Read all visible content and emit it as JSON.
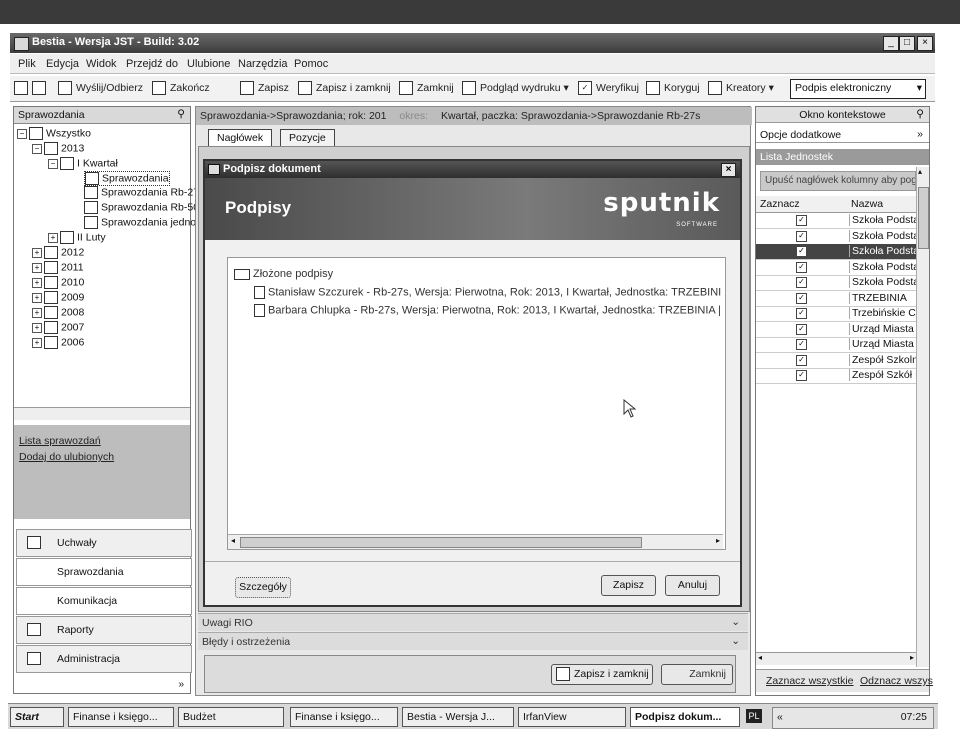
{
  "window": {
    "title": "Bestia - Wersja JST - Build: 3.02"
  },
  "menu": [
    "Plik",
    "Edycja",
    "Widok",
    "Przejdź do",
    "Ulubione",
    "Narzędzia",
    "Pomoc"
  ],
  "toolbar": {
    "send_receive": "Wyślij/Odbierz",
    "finish": "Zakończ",
    "save": "Zapisz",
    "save_close": "Zapisz i zamknij",
    "close": "Zamknij",
    "print_preview": "Podgląd wydruku",
    "verify": "Weryfikuj",
    "correct": "Koryguj",
    "wizards": "Kreatory",
    "e_signature": "Podpis elektroniczny"
  },
  "left_pane": {
    "title": "Sprawozdania",
    "tree": {
      "root": "Wszystko",
      "year_2013": "2013",
      "q1": "I Kwartał",
      "q1_children": [
        "Sprawozdania",
        "Sprawozdania Rb-27",
        "Sprawozdania Rb-50",
        "Sprawozdania jedno"
      ],
      "feb": "II Luty",
      "years": [
        "2012",
        "2011",
        "2010",
        "2009",
        "2008",
        "2007",
        "2006"
      ]
    },
    "links": {
      "report_list": "Lista sprawozdań",
      "add_favorites": "Dodaj do ulubionych"
    },
    "nav": {
      "resolutions": "Uchwały",
      "reports": "Sprawozdania",
      "communication": "Komunikacja",
      "raports": "Raporty",
      "admin": "Administracja"
    }
  },
  "center": {
    "breadcrumb_left": "Sprawozdania->Sprawozdania; rok: 201",
    "breadcrumb_mid": "okres:",
    "breadcrumb_right": "Kwartał, paczka: Sprawozdania->Sprawozdanie Rb-27s",
    "tabs": [
      "Nagłówek",
      "Pozycje"
    ],
    "section_rio": "Uwagi RIO",
    "section_errors": "Błędy i ostrzeżenia",
    "bottom_save_close": "Zapisz i zamknij",
    "bottom_close": "Zamknij"
  },
  "dialog": {
    "title": "Podpisz dokument",
    "header": "Podpisy",
    "logo": "sputnik",
    "logo_sub": "SOFTWARE",
    "group": "Złożone podpisy",
    "signatures": [
      "Stanisław Szczurek - Rb-27s, Wersja: Pierwotna, Rok: 2013, I Kwartał, Jednostka: TRZEBINI",
      "Barbara Chlupka - Rb-27s, Wersja: Pierwotna, Rok: 2013, I Kwartał, Jednostka: TRZEBINIA |"
    ],
    "details": "Szczegóły",
    "save": "Zapisz",
    "cancel": "Anuluj"
  },
  "right_pane": {
    "title": "Okno kontekstowe",
    "options": "Opcje dodatkowe",
    "unit_list": "Lista Jednostek",
    "group_hint": "Upuść nagłówek kolumny aby pog",
    "col_check": "Zaznacz",
    "col_name": "Nazwa",
    "rows": [
      {
        "checked": true,
        "name": "Szkoła Podsta"
      },
      {
        "checked": true,
        "name": "Szkoła Podsta"
      },
      {
        "checked": true,
        "name": "Szkoła Podsta"
      },
      {
        "checked": true,
        "name": "Szkoła Podsta"
      },
      {
        "checked": true,
        "name": "Szkoła Podsta"
      },
      {
        "checked": true,
        "name": "TRZEBINIA"
      },
      {
        "checked": true,
        "name": "Trzebińskie C"
      },
      {
        "checked": true,
        "name": "Urząd Miasta"
      },
      {
        "checked": true,
        "name": "Urząd Miasta"
      },
      {
        "checked": true,
        "name": "Zespół Szkoln"
      },
      {
        "checked": true,
        "name": "Zespół Szkół I"
      }
    ],
    "select_all": "Zaznacz wszystkie",
    "deselect_all": "Odznacz wszys"
  },
  "taskbar": {
    "start": "Start",
    "tasks": [
      "Finanse i księgo...",
      "Budżet",
      "Finanse i księgo...",
      "Bestia - Wersja J...",
      "IrfanView",
      "Podpisz dokum..."
    ],
    "lang": "PL",
    "time": "07:25"
  }
}
